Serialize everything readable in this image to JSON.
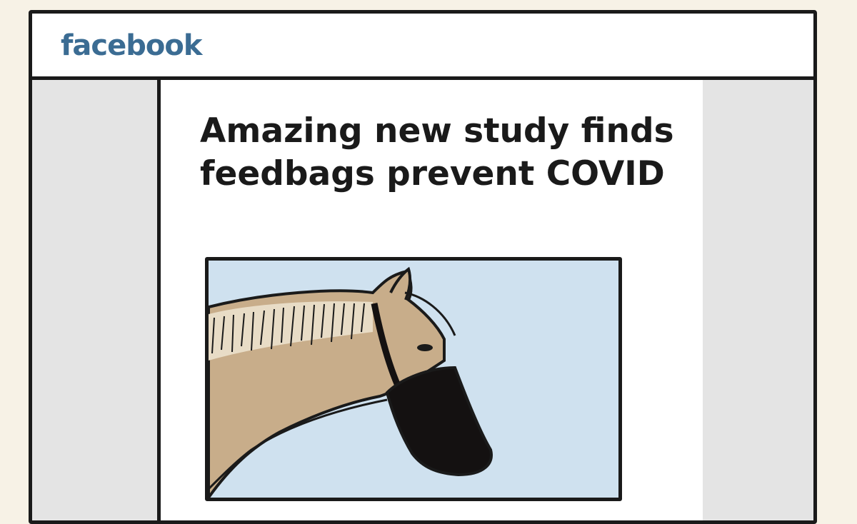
{
  "header": {
    "brand": "facebook"
  },
  "post": {
    "headline": "Amazing new study finds feedbags prevent COVID",
    "image": {
      "subject": "horse-wearing-feedbag",
      "sky_color": "#cfe1ef",
      "coat_color": "#c8ad8a",
      "feedbag_color": "#141111"
    }
  },
  "colors": {
    "background": "#f7f2e6",
    "brand": "#3b6c93",
    "sidebar": "#e4e4e4",
    "outline": "#1a1a1a"
  }
}
